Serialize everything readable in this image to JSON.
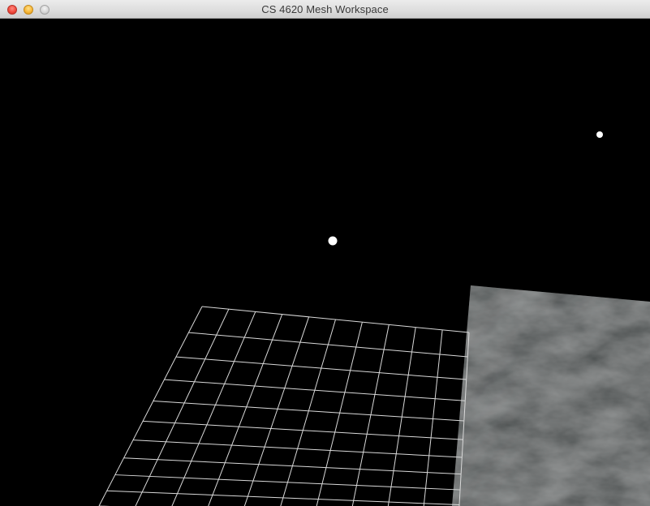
{
  "window": {
    "title": "CS 4620 Mesh Workspace"
  },
  "colors": {
    "viewport_background": "#000000",
    "grid_line": "#d9d9d9",
    "point_light": "#ffffff",
    "textured_plane": "#1f2222"
  },
  "icons": {
    "close": "close-icon",
    "minimize": "minimize-icon",
    "zoom": "zoom-icon"
  }
}
